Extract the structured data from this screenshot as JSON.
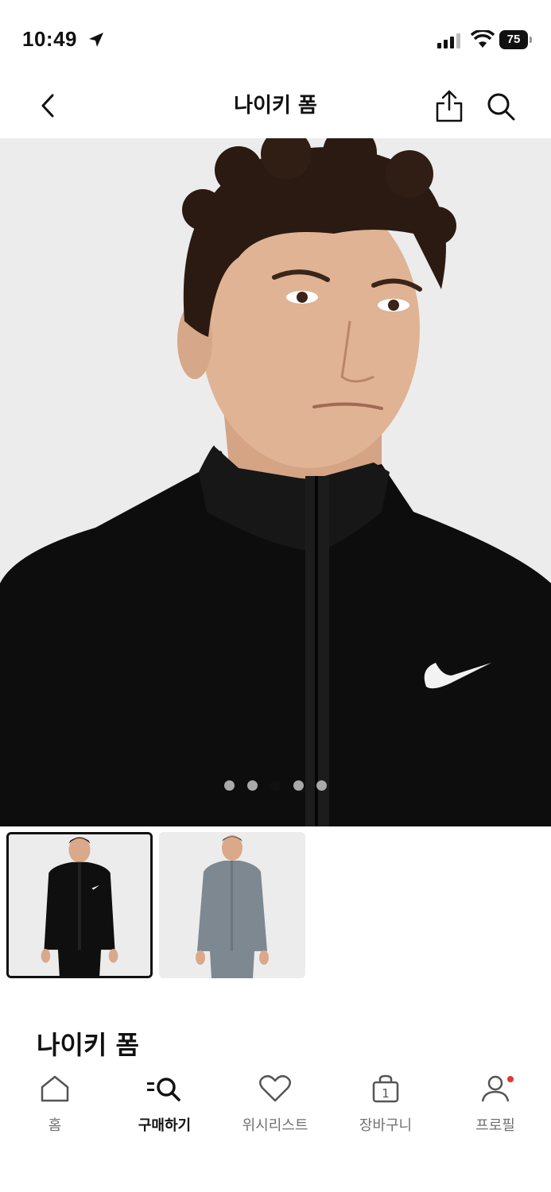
{
  "status_bar": {
    "time": "10:49",
    "battery": "75"
  },
  "header": {
    "title": "나이키 폼"
  },
  "gallery": {
    "slide_count": 5,
    "active_slide": 3,
    "thumbnails": [
      {
        "color": "black",
        "selected": true
      },
      {
        "color": "grey",
        "selected": false
      }
    ]
  },
  "product": {
    "name": "나이키 폼"
  },
  "tabbar": {
    "items": [
      {
        "label": "홈",
        "icon": "home-icon",
        "active": false
      },
      {
        "label": "구매하기",
        "icon": "shop-search-icon",
        "active": true
      },
      {
        "label": "위시리스트",
        "icon": "heart-icon",
        "active": false
      },
      {
        "label": "장바구니",
        "icon": "bag-icon",
        "active": false,
        "badge": "1"
      },
      {
        "label": "프로필",
        "icon": "profile-icon",
        "active": false,
        "notification": true
      }
    ]
  },
  "colors": {
    "accent": "#111111",
    "notification": "#e03a2f",
    "image_bg": "#ececec"
  }
}
